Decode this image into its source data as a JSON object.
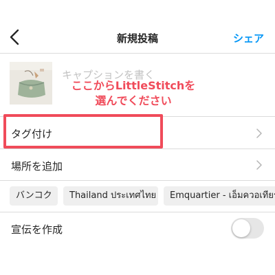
{
  "header": {
    "title": "新規投稿",
    "share_label": "シェア",
    "back_icon": "chevron-left-icon"
  },
  "compose": {
    "caption_placeholder": "キャプションを書く",
    "annotation_line1": "ここからLittleStitchを",
    "annotation_line2": "選んでください"
  },
  "options": {
    "tag_label": "タグ付け",
    "location_label": "場所を追加",
    "promotion_label": "宣伝を作成",
    "promotion_enabled": false
  },
  "location_suggestions": [
    "バンコク",
    "Thailand ประเทศไทย",
    "Emquartier - เอ็มควอเทียร์"
  ],
  "colors": {
    "accent": "#0095f6",
    "annotation": "#f04b5a"
  }
}
